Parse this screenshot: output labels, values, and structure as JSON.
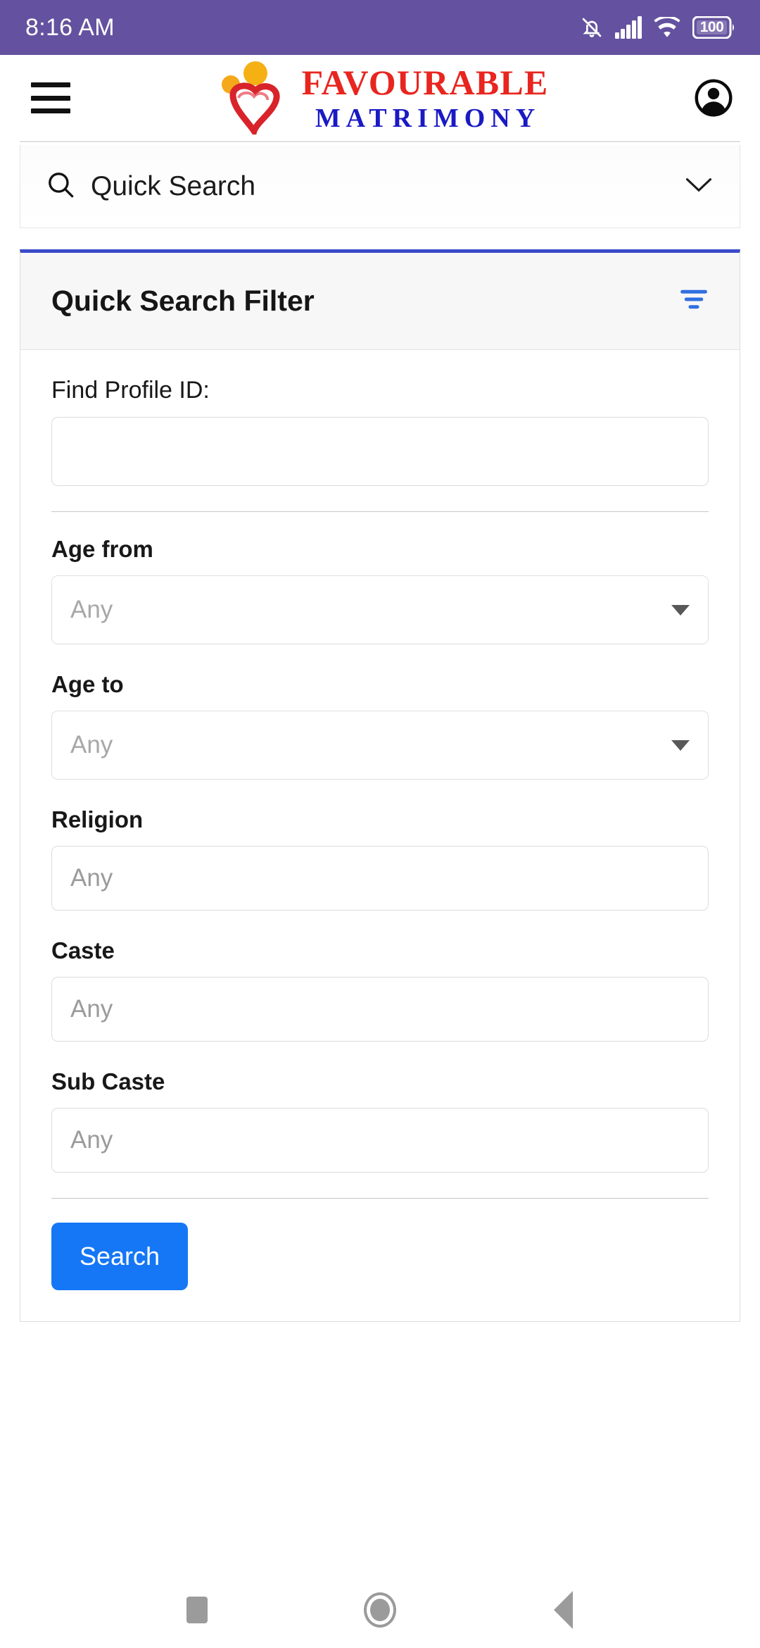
{
  "status_bar": {
    "time": "8:16 AM",
    "battery_level": "100",
    "icons": [
      "notifications-off-icon",
      "cellular-signal-icon",
      "wifi-icon",
      "battery-icon"
    ],
    "background_color": "#64519f"
  },
  "header": {
    "menu_icon": "hamburger-menu-icon",
    "logo": {
      "line1": "FAVOURABLE",
      "line2": "MATRIMONY",
      "line1_color": "#e8251f",
      "line2_color": "#1a1ac4",
      "mark": "heart-couple-logo-icon"
    },
    "account_icon": "account-circle-icon"
  },
  "quick_search": {
    "label": "Quick Search",
    "search_icon": "search-icon",
    "expand_icon": "chevron-down-icon"
  },
  "filter_card": {
    "title": "Quick Search Filter",
    "filter_icon": "filter-list-icon",
    "accent_color": "#3b4cc8",
    "fields": [
      {
        "name": "profile-id",
        "label": "Find Profile ID:",
        "type": "text",
        "value": "",
        "placeholder": ""
      },
      {
        "name": "age-from",
        "label": "Age from",
        "type": "select",
        "value": "",
        "placeholder": "Any"
      },
      {
        "name": "age-to",
        "label": "Age to",
        "type": "select",
        "value": "",
        "placeholder": "Any"
      },
      {
        "name": "religion",
        "label": "Religion",
        "type": "text",
        "value": "",
        "placeholder": "Any"
      },
      {
        "name": "caste",
        "label": "Caste",
        "type": "text",
        "value": "",
        "placeholder": "Any"
      },
      {
        "name": "sub-caste",
        "label": "Sub Caste",
        "type": "text",
        "value": "",
        "placeholder": "Any"
      }
    ],
    "submit_label": "Search",
    "submit_color": "#1577f5"
  },
  "nav_bar": {
    "recents_icon": "square-recents-icon",
    "home_icon": "circle-home-icon",
    "back_icon": "triangle-back-icon"
  }
}
